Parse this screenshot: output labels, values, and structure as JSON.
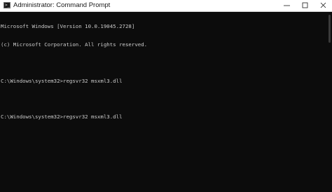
{
  "window": {
    "title": "Administrator: Command Prompt",
    "icon": "cmd-icon"
  },
  "controls": {
    "minimize": "minimize-icon",
    "maximize": "maximize-icon",
    "close": "close-icon"
  },
  "console": {
    "lines": [
      "Microsoft Windows [Version 10.0.19045.2728]",
      "(c) Microsoft Corporation. All rights reserved.",
      "",
      "C:\\Windows\\system32>regsvr32 msxml3.dll",
      "",
      "C:\\Windows\\system32>regsvr32 msxml3.dll"
    ]
  },
  "colors": {
    "console_bg": "#0c0c0c",
    "console_fg": "#cccccc",
    "titlebar_bg": "#ffffff"
  }
}
